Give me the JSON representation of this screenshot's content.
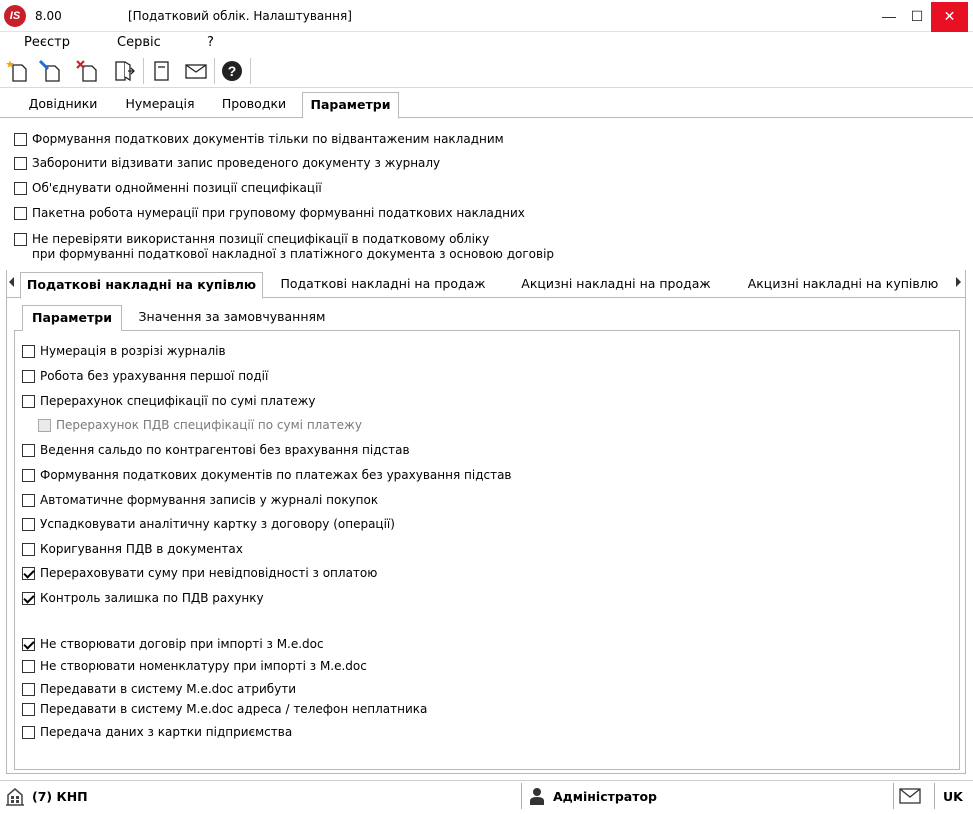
{
  "window": {
    "version": "8.00",
    "title": "[Податковий облік. Налаштування]",
    "logo_text": "IS",
    "minimize": "—",
    "maximize": "☐",
    "close": "✕"
  },
  "menu": {
    "items": [
      "Реєстр",
      "Сервіс",
      "?"
    ]
  },
  "toolbar": {
    "buttons": [
      "new-doc-icon",
      "edit-doc-icon",
      "delete-doc-icon",
      "exit-icon",
      "form-icon",
      "mail-icon",
      "help-icon"
    ]
  },
  "top_tabs": {
    "items": [
      "Довідники",
      "Нумерація",
      "Проводки",
      "Параметри"
    ],
    "active": "Параметри"
  },
  "general_options": [
    {
      "label": "Формування податкових документів тільки по відвантаженим накладним",
      "checked": false
    },
    {
      "label": "Заборонити відзивати запис проведеного документу з журналу",
      "checked": false
    },
    {
      "label": "Об'єднувати однойменні позиції специфікації",
      "checked": false
    },
    {
      "label": "Пакетна робота нумерації при груповому формуванні податкових накладних",
      "checked": false
    },
    {
      "label": "Не перевіряти використання позиції специфікації в податковому обліку",
      "label2": "при формуванні податкової накладної з платіжного документа з основою договір",
      "checked": false
    }
  ],
  "doc_tabs": {
    "items": [
      "Податкові накладні на купівлю",
      "Податкові накладні на продаж",
      "Акцизні накладні на продаж",
      "Акцизні накладні на купівлю"
    ],
    "active": "Податкові накладні на купівлю"
  },
  "inner_tabs": {
    "items": [
      "Параметри",
      "Значення за замовчуванням"
    ],
    "active": "Параметри"
  },
  "purchase_options": [
    {
      "label": "Нумерація в розрізі журналів",
      "checked": false
    },
    {
      "label": "Робота без урахування першої події",
      "checked": false
    },
    {
      "label": "Перерахунок специфікації по сумі платежу",
      "checked": false
    },
    {
      "label": "Перерахунок ПДВ специфікації по сумі платежу",
      "checked": false,
      "disabled": true
    },
    {
      "label": "Ведення сальдо по контрагентові без врахування підстав",
      "checked": false
    },
    {
      "label": "Формування податкових документів по платежах без урахування підстав",
      "checked": false
    },
    {
      "label": "Автоматичне формування записів у журналі покупок",
      "checked": false
    },
    {
      "label": "Успадковувати аналітичну картку з договору (операції)",
      "checked": false
    },
    {
      "label": "Коригування ПДВ в документах",
      "checked": false
    },
    {
      "label": "Перераховувати суму при невідповідності з оплатою",
      "checked": true
    },
    {
      "label": "Контроль залишка по ПДВ рахунку",
      "checked": true
    }
  ],
  "medoc_options": [
    {
      "label": "Не створювати договір при імпорті з M.e.doc",
      "checked": true
    },
    {
      "label": "Не створювати номенклатуру при імпорті з M.e.doc",
      "checked": false
    },
    {
      "label": "Передавати в систему M.e.doc атрибути",
      "checked": false
    },
    {
      "label": "Передавати в систему M.e.doc  адреса / телефон неплатника",
      "checked": false
    },
    {
      "label": "Передача даних з картки підприємства",
      "checked": false
    }
  ],
  "status": {
    "company": "(7) КНП",
    "user": "Адміністратор",
    "lang": "UK"
  }
}
